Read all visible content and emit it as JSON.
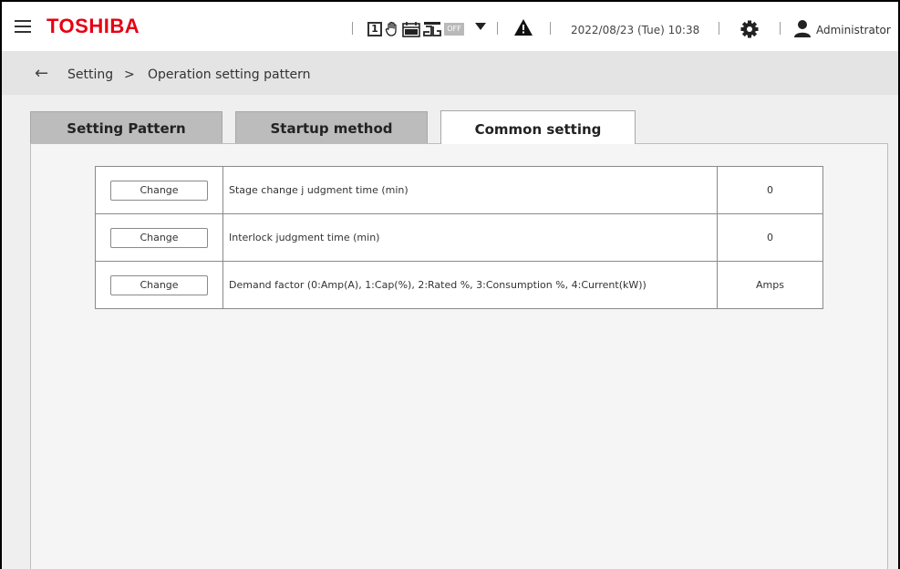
{
  "header": {
    "logo": "TOSHIBA",
    "status_icons": {
      "box_number": "1",
      "off_label": "OFF",
      "icons": [
        "box-one-icon",
        "hand-icon",
        "schedule-off-icon",
        "interlock-icon",
        "off-tag-icon"
      ]
    },
    "datetime": "2022/08/23 (Tue) 10:38",
    "user": "Administrator"
  },
  "breadcrumb": {
    "items": [
      "Setting",
      ">",
      "Operation setting pattern"
    ]
  },
  "tabs": [
    {
      "label": "Setting Pattern",
      "active": false
    },
    {
      "label": "Startup method",
      "active": false
    },
    {
      "label": "Common setting",
      "active": true
    }
  ],
  "settings": {
    "rows": [
      {
        "button": "Change",
        "label": "Stage change j udgment time (min)",
        "value": "0"
      },
      {
        "button": "Change",
        "label": "Interlock judgment time (min)",
        "value": "0"
      },
      {
        "button": "Change",
        "label": "Demand factor (0:Amp(A), 1:Cap(%), 2:Rated %, 3:Consumption %, 4:Current(kW))",
        "value": "Amps"
      }
    ]
  },
  "colors": {
    "brand": "#e60012",
    "crumb_bg": "#e4e4e4",
    "tab_inactive": "#bcbcbc",
    "content_bg": "#efefef"
  }
}
